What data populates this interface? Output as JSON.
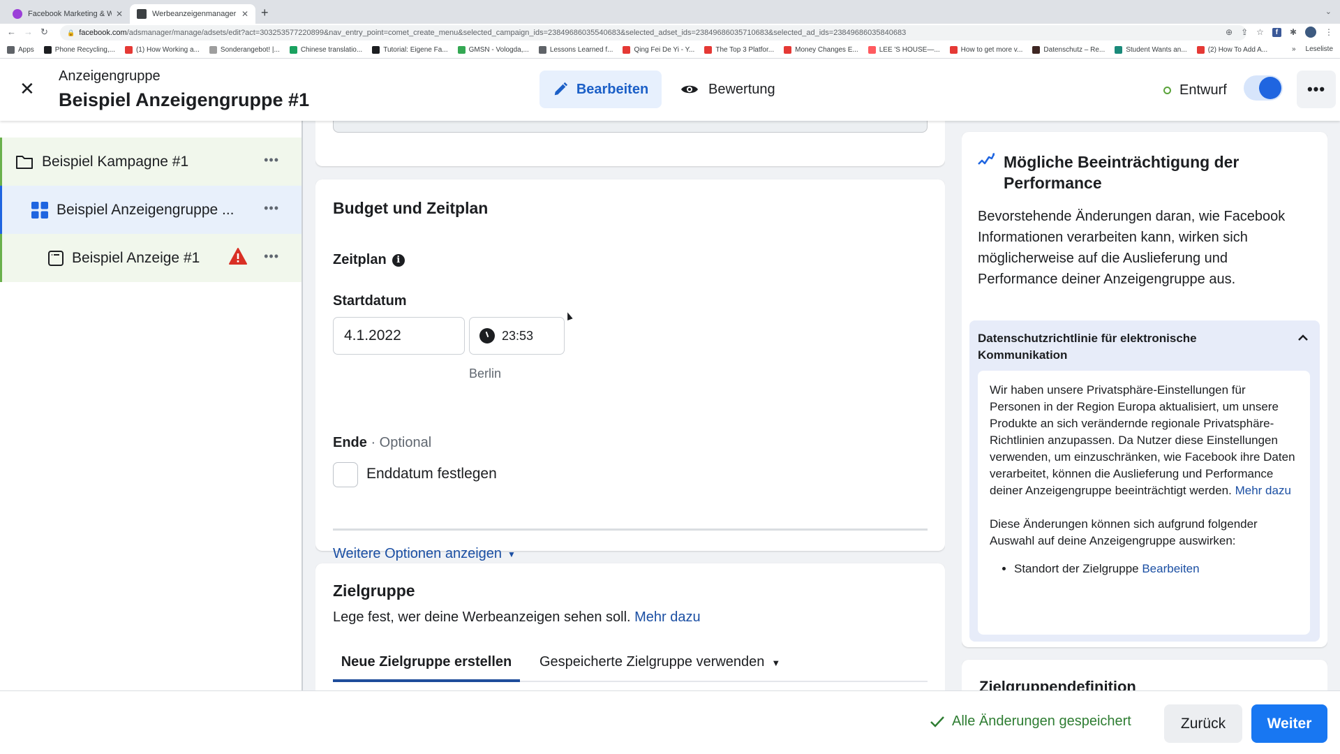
{
  "browser": {
    "tabs": [
      {
        "title": "Facebook Marketing & Werbea",
        "active": false,
        "favicon_color": "#9b3fd8"
      },
      {
        "title": "Werbeanzeigenmanager - Wer",
        "active": true,
        "favicon_color": "#3c4043"
      }
    ],
    "url_host": "facebook.com",
    "url_path": "/adsmanager/manage/adsets/edit?act=303253577220899&nav_entry_point=comet_create_menu&selected_campaign_ids=23849686035540683&selected_adset_ids=23849686035710683&selected_ad_ids=23849686035840683",
    "bookmarks": [
      {
        "label": "Apps",
        "color": "#5f6368"
      },
      {
        "label": "Phone Recycling,...",
        "color": "#1c1e21"
      },
      {
        "label": "(1) How Working a...",
        "color": "#e53935"
      },
      {
        "label": "Sonderangebot! |...",
        "color": "#9e9e9e"
      },
      {
        "label": "Chinese translatio...",
        "color": "#1aa260"
      },
      {
        "label": "Tutorial: Eigene Fa...",
        "color": "#1c1e21"
      },
      {
        "label": "GMSN - Vologda,...",
        "color": "#34a853"
      },
      {
        "label": "Lessons Learned f...",
        "color": "#5f6368"
      },
      {
        "label": "Qing Fei De Yi - Y...",
        "color": "#e53935"
      },
      {
        "label": "The Top 3 Platfor...",
        "color": "#e53935"
      },
      {
        "label": "Money Changes E...",
        "color": "#e53935"
      },
      {
        "label": "LEE 'S HOUSE—...",
        "color": "#ff5a5f"
      },
      {
        "label": "How to get more v...",
        "color": "#e53935"
      },
      {
        "label": "Datenschutz – Re...",
        "color": "#3e2723"
      },
      {
        "label": "Student Wants an...",
        "color": "#1a8a7a"
      },
      {
        "label": "(2) How To Add A...",
        "color": "#e53935"
      }
    ],
    "overflow_label": "»",
    "reading_list": "Leseliste"
  },
  "header": {
    "subtitle": "Anzeigengruppe",
    "title": "Beispiel Anzeigengruppe #1",
    "edit_label": "Bearbeiten",
    "review_label": "Bewertung",
    "status_label": "Entwurf",
    "toggle_on": true
  },
  "tree": {
    "items": [
      {
        "label": "Beispiel Kampagne #1",
        "type": "campaign"
      },
      {
        "label": "Beispiel Anzeigengruppe ...",
        "type": "adset"
      },
      {
        "label": "Beispiel Anzeige #1",
        "type": "ad",
        "warning": true
      }
    ]
  },
  "budget": {
    "title": "Budget und Zeitplan",
    "schedule_label": "Zeitplan",
    "start_label": "Startdatum",
    "start_date": "4.1.2022",
    "start_time": "23:53",
    "timezone": "Berlin",
    "end_label": "Ende",
    "end_optional": " · Optional",
    "end_checkbox_label": "Enddatum festlegen",
    "end_checked": false,
    "more_options": "Weitere Optionen anzeigen"
  },
  "audience": {
    "title": "Zielgruppe",
    "subtitle": "Lege fest, wer deine Werbeanzeigen sehen soll.",
    "learn_more": "Mehr dazu",
    "tabs": [
      {
        "label": "Neue Zielgruppe erstellen",
        "active": true
      },
      {
        "label": "Gespeicherte Zielgruppe verwenden",
        "active": false
      }
    ]
  },
  "right_panel": {
    "title": "Mögliche Beeinträchtigung der Performance",
    "body": "Bevorstehende Änderungen daran, wie Facebook Informationen verarbeiten kann, wirken sich möglicherweise auf die Auslieferung und Performance deiner Anzeigengruppe aus.",
    "accordion_title": "Datenschutzrichtlinie für elektronische Kommunikation",
    "accordion_p1": "Wir haben unsere Privatsphäre-Einstellungen für Personen in der Region Europa aktualisiert, um unsere Produkte an sich verändernde regionale Privatsphäre-Richtlinien anzupassen. Da Nutzer diese Einstellungen verwenden, um einzuschränken, wie Facebook ihre Daten verarbeitet, können die Auslieferung und Performance deiner Anzeigengruppe beeinträchtigt werden.",
    "accordion_p1_link": "Mehr dazu",
    "accordion_p2": "Diese Änderungen können sich aufgrund folgender Auswahl auf deine Anzeigengruppe auswirken:",
    "list_item": "Standort der Zielgruppe",
    "list_item_link": "Bearbeiten",
    "next_card_title": "Zielgruppendefinition"
  },
  "footer": {
    "saved_label": "Alle Änderungen gespeichert",
    "back_label": "Zurück",
    "next_label": "Weiter"
  },
  "colors": {
    "primary": "#1877f2",
    "link": "#1b4fa3",
    "success": "#2e7d32",
    "warning": "#d93025"
  }
}
